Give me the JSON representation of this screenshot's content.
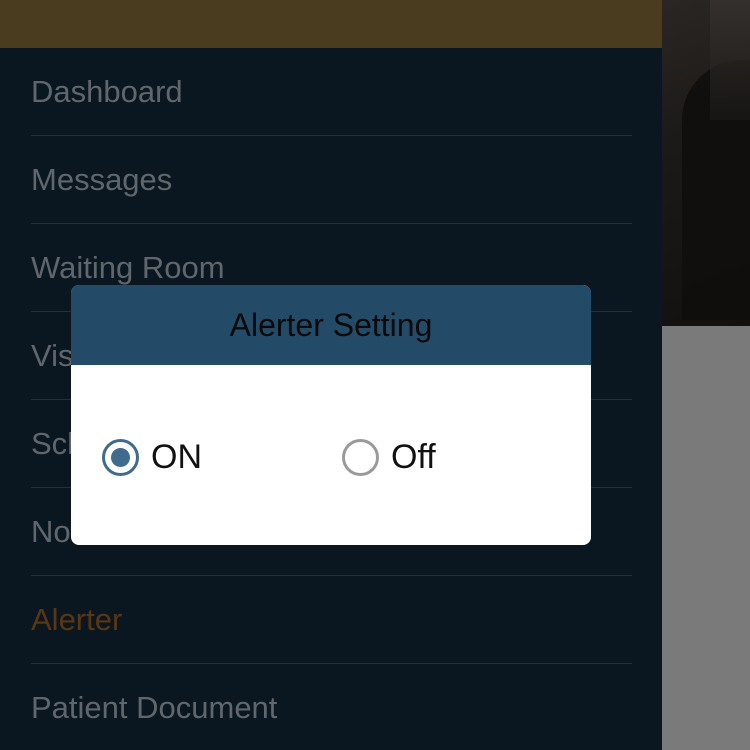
{
  "menu": {
    "items": [
      {
        "label": "Dashboard"
      },
      {
        "label": "Messages"
      },
      {
        "label": "Waiting Room"
      },
      {
        "label": "Visit"
      },
      {
        "label": "Schedule"
      },
      {
        "label": "Notifications"
      },
      {
        "label": "Alerter"
      },
      {
        "label": "Patient Document"
      }
    ]
  },
  "dialog": {
    "title": "Alerter Setting",
    "options": [
      {
        "label": "ON",
        "selected": true
      },
      {
        "label": "Off",
        "selected": false
      }
    ]
  },
  "colors": {
    "menu_header": "#4a3c1f",
    "menu_bg": "#0b1720",
    "dialog_header": "#234b68",
    "radio_checked": "#3f6b8d",
    "active_item": "#5a3612"
  }
}
